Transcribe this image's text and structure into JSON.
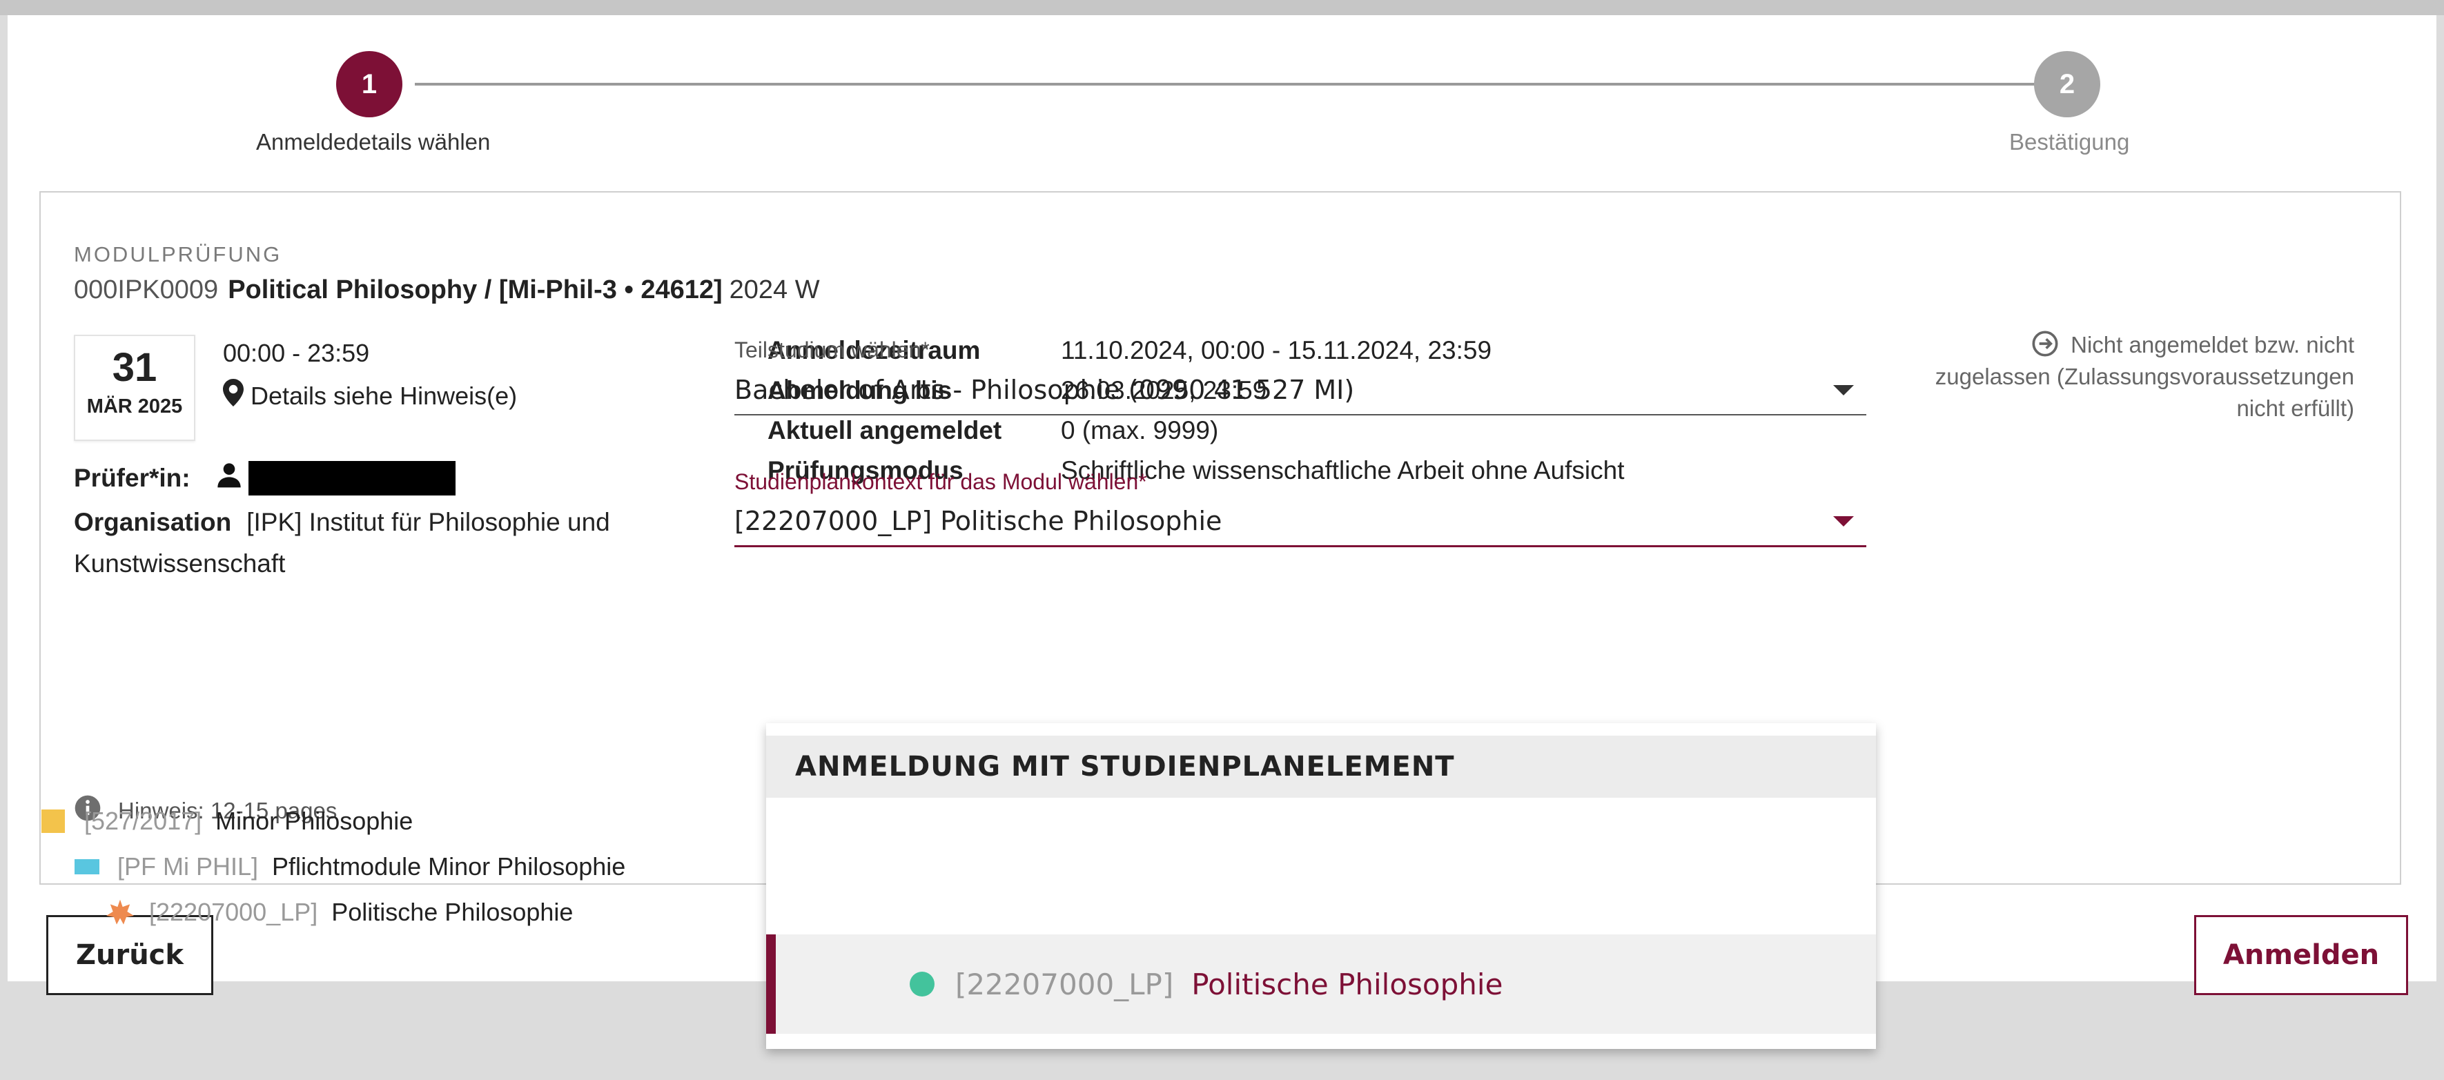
{
  "stepper": {
    "steps": [
      {
        "number": "1",
        "label": "Anmeldedetails wählen",
        "state": "active"
      },
      {
        "number": "2",
        "label": "Bestätigung",
        "state": "inactive"
      }
    ]
  },
  "module": {
    "type_label": "MODULPRÜFUNG",
    "code": "000IPK0009",
    "name": "Political Philosophy / [Mi-Phil-3 • 24612]",
    "semester": "2024 W",
    "date_day": "31",
    "date_month": "MÄR 2025",
    "time": "00:00 - 23:59",
    "location": "Details siehe Hinweis(e)",
    "examiner_label": "Prüfer*in:",
    "organisation_label": "Organisation",
    "organisation_value": "[IPK] Institut für Philosophie und Kunstwissenschaft",
    "hint": "Hinweis: 12-15 pages"
  },
  "info": {
    "rows": [
      {
        "key": "Anmeldezeitraum",
        "value": "11.10.2024, 00:00 - 15.11.2024, 23:59"
      },
      {
        "key": "Abmeldung bis",
        "value": "26.03.2025, 23:59"
      },
      {
        "key": "Aktuell angemeldet",
        "value": "0 (max. 9999)"
      },
      {
        "key": "Prüfungsmodus",
        "value": "Schriftliche wissenschaftliche Arbeit ohne Aufsicht"
      }
    ]
  },
  "status": {
    "text": "Nicht angemeldet bzw. nicht zugelassen (Zulassungsvoraussetzungen nicht erfüllt)"
  },
  "form": {
    "teilstudium_label": "Teilstudium wählen*",
    "teilstudium_value": "Bachelor of Arts - Philosophie (0990 41 527 MI)",
    "kontext_label": "Studienplankontext für das Modul wählen*",
    "kontext_value": "[22207000_LP]  Politische Philosophie"
  },
  "dropdown": {
    "header": "ANMELDUNG MIT STUDIENPLANELEMENT",
    "items": [
      {
        "code": "[527/2017]",
        "label": "Minor Philosophie",
        "icon": "square-icon",
        "color": "#f3c34b"
      },
      {
        "code": "[PF Mi PHIL]",
        "label": "Pflichtmodule Minor Philosophie",
        "icon": "rectangle-icon",
        "color": "#59c6e0"
      },
      {
        "code": "[22207000_LP]",
        "label": "Politische Philosophie",
        "icon": "star-icon",
        "color": "#ee8a4f"
      }
    ],
    "selected": {
      "code": "[22207000_LP]",
      "label": "Politische Philosophie",
      "icon": "circle-icon",
      "color": "#43c39c"
    }
  },
  "buttons": {
    "back": "Zurück",
    "submit": "Anmelden"
  },
  "colors": {
    "accent": "#7d1036",
    "inactive": "#a6a6a6"
  }
}
